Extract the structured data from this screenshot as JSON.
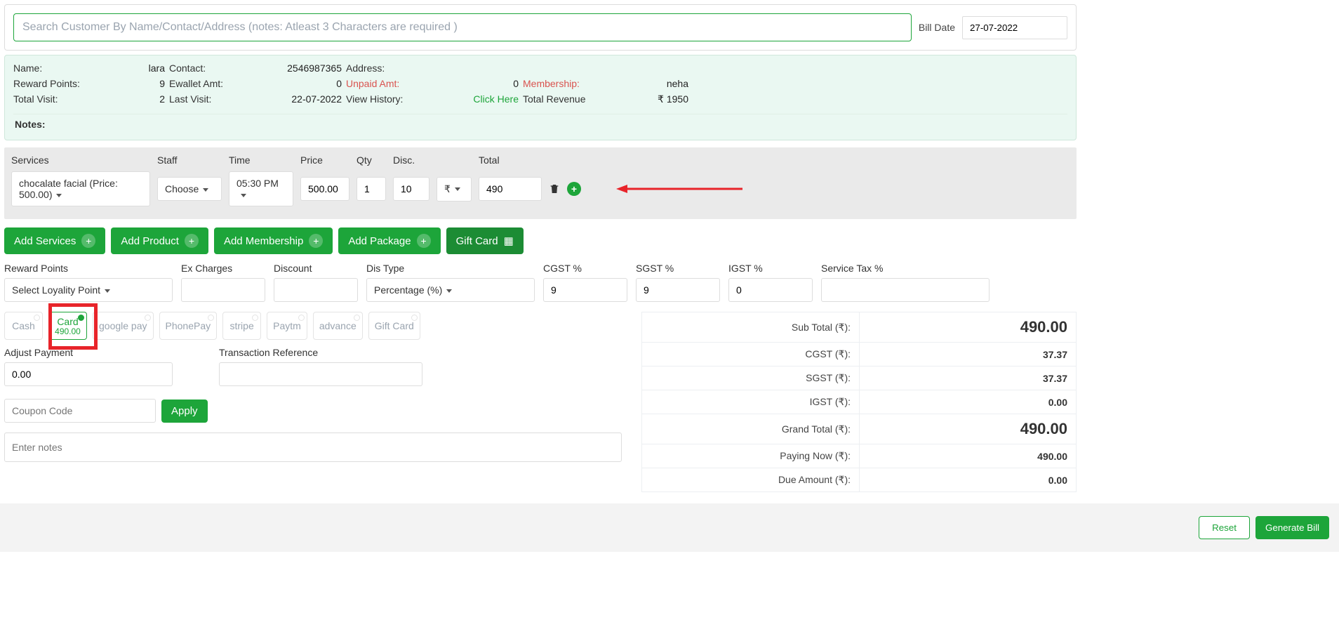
{
  "search": {
    "placeholder": "Search Customer By Name/Contact/Address (notes: Atleast 3 Characters are required )"
  },
  "billDate": {
    "label": "Bill Date",
    "value": "27-07-2022"
  },
  "customer": {
    "labels": {
      "name": "Name:",
      "contact": "Contact:",
      "address": "Address:",
      "reward": "Reward Points:",
      "ewallet": "Ewallet Amt:",
      "unpaid": "Unpaid Amt:",
      "membership": "Membership:",
      "total_visit": "Total Visit:",
      "last_visit": "Last Visit:",
      "view_history": "View History:",
      "click_here": "Click Here",
      "total_revenue": "Total Revenue",
      "notes": "Notes:"
    },
    "values": {
      "name": "lara",
      "contact": "2546987365",
      "address": "",
      "reward": "9",
      "ewallet": "0",
      "unpaid": "0",
      "membership": "neha",
      "total_visit": "2",
      "last_visit": "22-07-2022",
      "total_revenue": "₹ 1950"
    }
  },
  "service_headers": {
    "services": "Services",
    "staff": "Staff",
    "time": "Time",
    "price": "Price",
    "qty": "Qty",
    "disc": "Disc.",
    "total": "Total"
  },
  "service_row": {
    "service": "chocalate facial (Price: 500.00)",
    "staff": "Choose",
    "time": "05:30 PM",
    "price": "500.00",
    "qty": "1",
    "disc": "10",
    "disc_type": "₹",
    "total": "490"
  },
  "buttons": {
    "add_services": "Add Services",
    "add_product": "Add Product",
    "add_membership": "Add Membership",
    "add_package": "Add Package",
    "gift_card": "Gift Card",
    "apply": "Apply",
    "reset": "Reset",
    "generate": "Generate Bill"
  },
  "fields": {
    "labels": {
      "reward_points": "Reward Points",
      "ex_charges": "Ex Charges",
      "discount": "Discount",
      "dis_type": "Dis Type",
      "cgst": "CGST %",
      "sgst": "SGST %",
      "igst": "IGST %",
      "stax": "Service Tax %",
      "adjust_payment": "Adjust Payment",
      "txn_ref": "Transaction Reference"
    },
    "values": {
      "reward_points": "Select Loyality Point",
      "dis_type": "Percentage (%)",
      "cgst": "9",
      "sgst": "9",
      "igst": "0",
      "adjust_payment": "0.00"
    },
    "placeholders": {
      "coupon": "Coupon Code",
      "notes": "Enter notes"
    }
  },
  "pay_modes": {
    "cash": "Cash",
    "card": "Card",
    "card_amt": "490.00",
    "gpay": "google pay",
    "phonepe": "PhonePay",
    "stripe": "stripe",
    "paytm": "Paytm",
    "advance": "advance",
    "giftcard": "Gift Card"
  },
  "totals": {
    "labels": {
      "sub": "Sub Total (₹):",
      "cgst": "CGST (₹):",
      "sgst": "SGST (₹):",
      "igst": "IGST (₹):",
      "grand": "Grand Total (₹):",
      "paying": "Paying Now (₹):",
      "due": "Due Amount (₹):"
    },
    "values": {
      "sub": "490.00",
      "cgst": "37.37",
      "sgst": "37.37",
      "igst": "0.00",
      "grand": "490.00",
      "paying": "490.00",
      "due": "0.00"
    }
  }
}
